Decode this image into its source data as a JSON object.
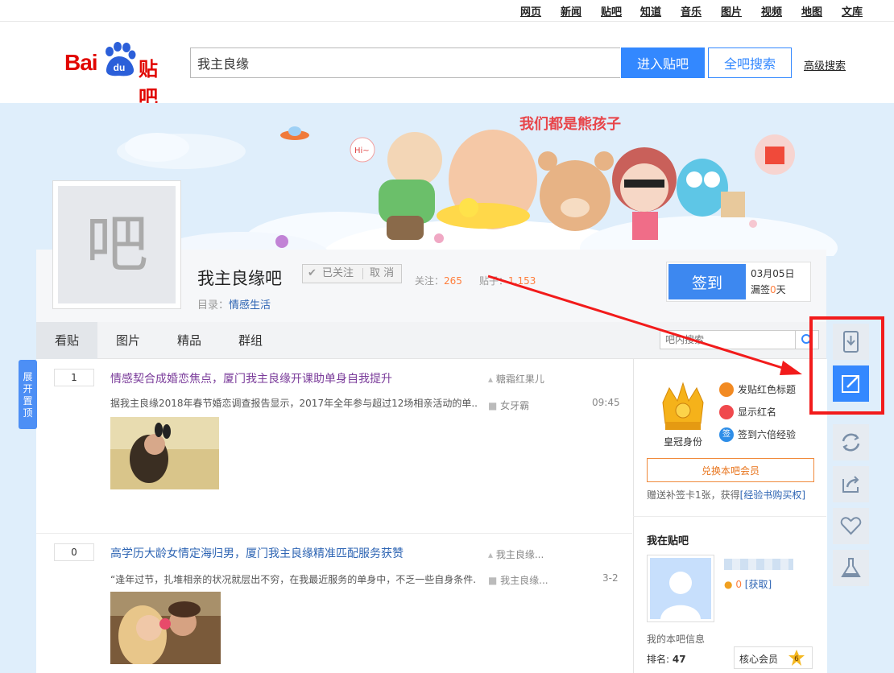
{
  "top_nav": [
    "网页",
    "新闻",
    "贴吧",
    "知道",
    "音乐",
    "图片",
    "视频",
    "地图",
    "文库"
  ],
  "logo": {
    "bai": "Bai",
    "du": "du",
    "tieba": "贴吧"
  },
  "search": {
    "value": "我主良缘",
    "enter_label": "进入贴吧",
    "all_label": "全吧搜索",
    "advanced_label": "高级搜索"
  },
  "banner": {
    "slogan": "我们都是熊孩子",
    "hi": "Hi~"
  },
  "forum": {
    "avatar_char": "吧",
    "name": "我主良缘吧",
    "follow_label": "已关注",
    "unfollow_label": "取 消",
    "follow_count_label": "关注：",
    "follow_count": "265",
    "post_count_label": "贴子：",
    "post_count": "1,153",
    "catalog_label": "目录：",
    "catalog_value": "情感生活"
  },
  "sign": {
    "button": "签到",
    "date": "03月05日",
    "missed_prefix": "漏签",
    "missed_count": "0",
    "missed_suffix": "天"
  },
  "tabs": [
    "看贴",
    "图片",
    "精品",
    "群组"
  ],
  "bar_search": {
    "placeholder": "吧内搜索"
  },
  "expand_tab": [
    "展",
    "开",
    "置",
    "顶"
  ],
  "threads": [
    {
      "replies": "1",
      "title": "情感契合成婚恋焦点，厦门我主良缘开课助单身自我提升",
      "excerpt": "据我主良缘2018年春节婚恋调查报告显示，2017年全年参与超过12场相亲活动的单...",
      "author": "糖霜红果儿",
      "last_reply": "女牙霸",
      "time": "09:45"
    },
    {
      "replies": "0",
      "title": "高学历大龄女情定海归男，厦门我主良缘精准匹配服务获赞",
      "excerpt": "“逢年过节，扎堆相亲的状况就层出不穷，在我最近服务的单身中，不乏一些自身条件...",
      "author": "我主良缘...",
      "last_reply": "我主良缘...",
      "time": "3-2"
    }
  ],
  "member": {
    "crown_label": "皇冠身份",
    "perks": [
      "发贴红色标题",
      "显示红名",
      "签到六倍经验"
    ],
    "perk_icon_3": "签",
    "redeem_label": "兑换本吧会员",
    "note_prefix": "赠送补签卡1张，获得",
    "note_link": "[经验书购买权]"
  },
  "my_forum": {
    "heading": "我在贴吧",
    "coins": "0",
    "get_label": "[获取]",
    "info_label": "我的本吧信息",
    "rank_label": "排名:",
    "rank_value": "47",
    "core_label": "核心会员",
    "level": "6"
  },
  "tools": [
    "download-icon",
    "edit-icon",
    "refresh-icon",
    "share-icon",
    "heart-icon",
    "flask-icon"
  ],
  "colors": {
    "brand_blue": "#3388ff",
    "baidu_red": "#e10601",
    "annotation_red": "#f21b1b",
    "count_orange": "#ff7f3e"
  }
}
